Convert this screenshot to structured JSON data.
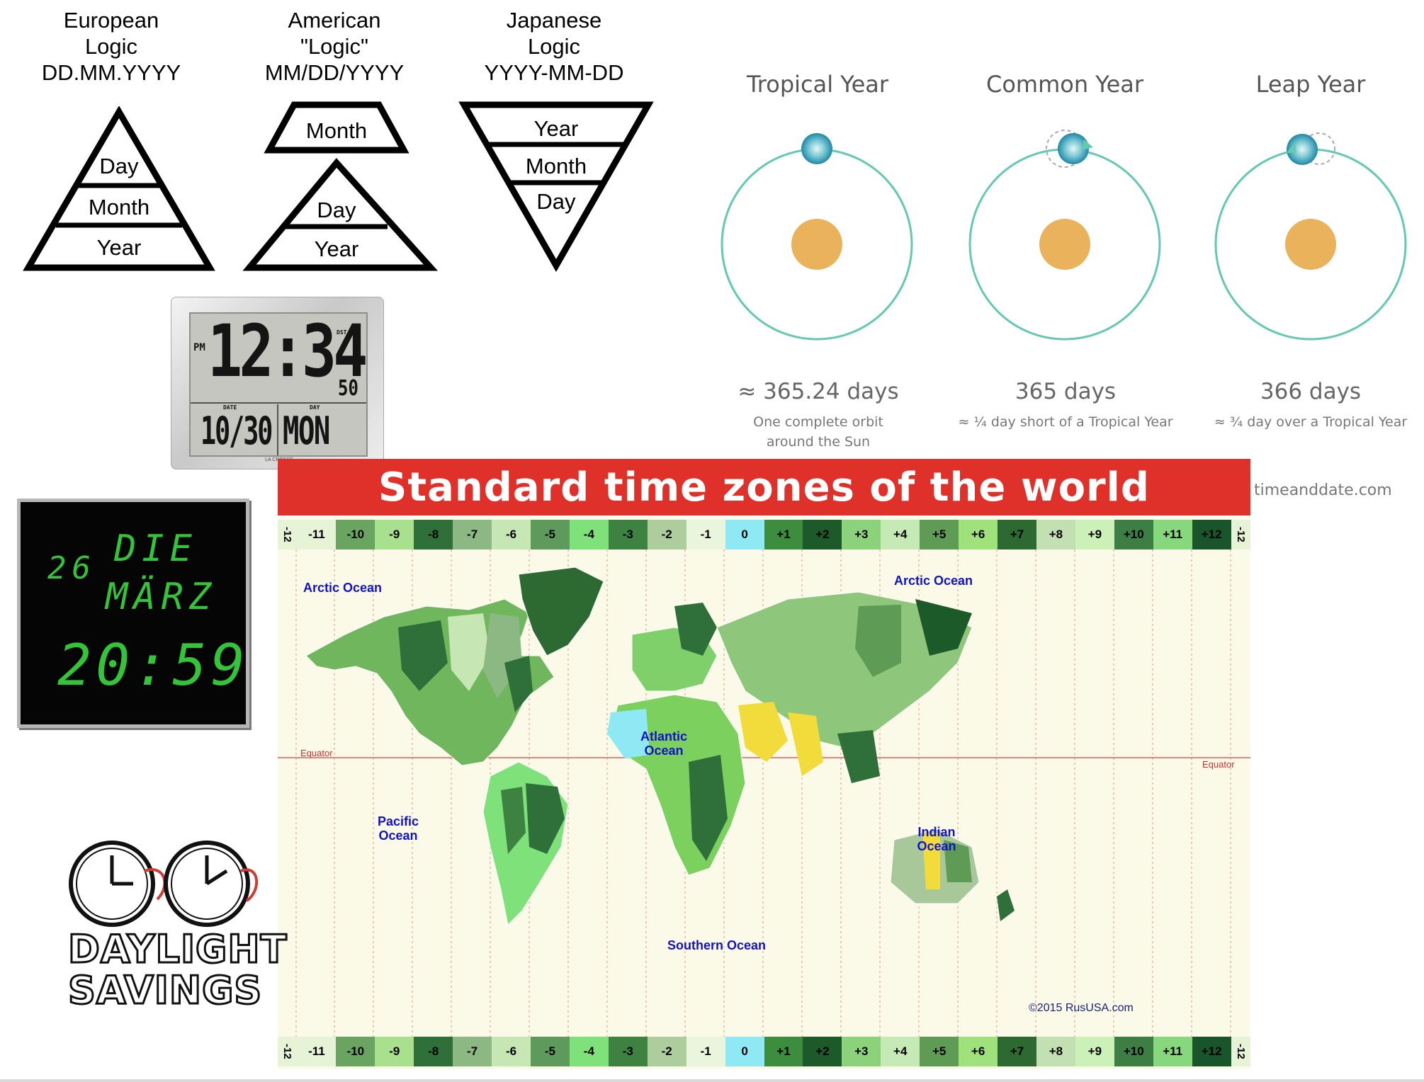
{
  "date_formats": [
    {
      "title_lines": [
        "European",
        "Logic",
        "DD.MM.YYYY"
      ],
      "tiers": [
        "Day",
        "Month",
        "Year"
      ]
    },
    {
      "title_lines": [
        "American",
        "\"Logic\"",
        "MM/DD/YYYY"
      ],
      "tiers": [
        "Month",
        "Day",
        "Year"
      ]
    },
    {
      "title_lines": [
        "Japanese",
        "Logic",
        "YYYY-MM-DD"
      ],
      "tiers": [
        "Year",
        "Month",
        "Day"
      ]
    }
  ],
  "lcd_clock": {
    "ampm": "PM",
    "time": "12:34",
    "seconds": "50",
    "date_label": "DATE",
    "day_label": "DAY",
    "date": "10/30",
    "day": "MON",
    "dst": "DST",
    "brand": "LA CROSSE"
  },
  "led_clock": {
    "day_num": "26",
    "weekday": "DIE",
    "month": "MÄRZ",
    "time": "20:59"
  },
  "orbits": [
    {
      "title": "Tropical Year",
      "days": "≈ 365.24 days",
      "note_lines": [
        "One complete orbit",
        "around the Sun"
      ],
      "ghost": "none"
    },
    {
      "title": "Common Year",
      "days": "365 days",
      "note_lines": [
        "≈ ¼ day short of a Tropical Year"
      ],
      "ghost": "ahead"
    },
    {
      "title": "Leap Year",
      "days": "366 days",
      "note_lines": [
        "≈ ¾ day over a Tropical Year"
      ],
      "ghost": "behind"
    }
  ],
  "orbit_credit": "timeanddate.com",
  "map": {
    "title": "Standard time zones of the world",
    "zones": [
      "-12",
      "-11",
      "-10",
      "-9",
      "-8",
      "-7",
      "-6",
      "-5",
      "-4",
      "-3",
      "-2",
      "-1",
      "0",
      "+1",
      "+2",
      "+3",
      "+4",
      "+5",
      "+6",
      "+7",
      "+8",
      "+9",
      "+10",
      "+11",
      "+12",
      "-12"
    ],
    "zone_colors": [
      "#e6f3d7",
      "#e6f3d7",
      "#6aa461",
      "#a8e08e",
      "#2f6f3a",
      "#8bb883",
      "#c6e7b3",
      "#5e9a5c",
      "#7fe17a",
      "#3d8241",
      "#aecd9c",
      "#e9f6dd",
      "#8ee9f5",
      "#3d8d3f",
      "#1d5a2a",
      "#8cd27b",
      "#c6eab6",
      "#5e9b55",
      "#9fe27c",
      "#2d6a32",
      "#c2e0b1",
      "#ccf1b8",
      "#3c7e44",
      "#87d87d",
      "#19552a",
      "#e6f3d7"
    ],
    "oceans": {
      "arctic_left": "Arctic Ocean",
      "arctic_right": "Arctic Ocean",
      "atlantic": [
        "Atlantic",
        "Ocean"
      ],
      "pacific": [
        "Pacific",
        "Ocean"
      ],
      "indian": [
        "Indian",
        "Ocean"
      ],
      "southern": "Southern Ocean"
    },
    "equator": "Equator",
    "copyright": "©2015 RusUSA.com"
  },
  "daylight_savings": {
    "lines": [
      "DAYLIGHT",
      "SAVINGS"
    ]
  }
}
